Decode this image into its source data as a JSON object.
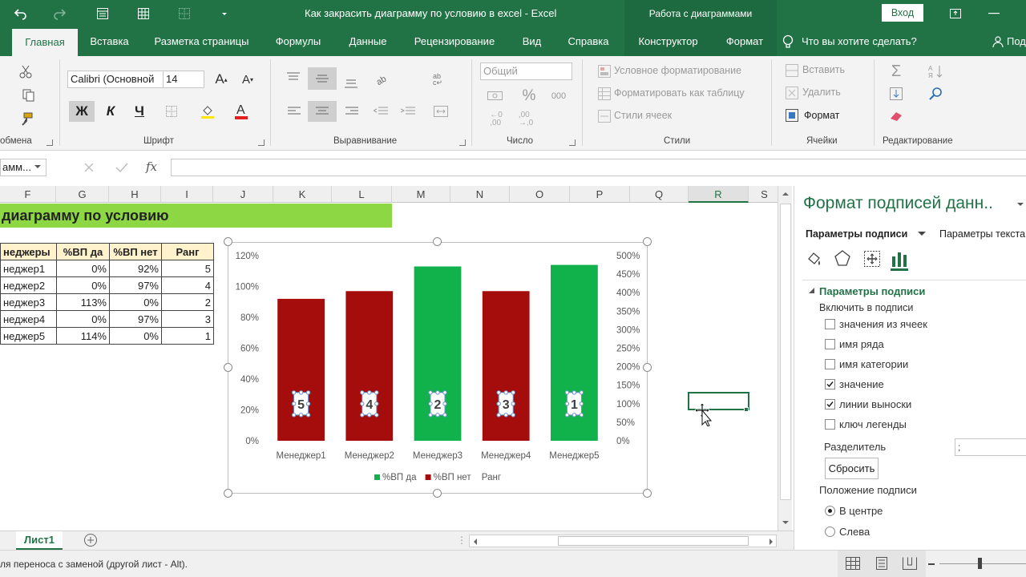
{
  "titlebar": {
    "title": "Как закрасить диаграмму по условию в excel  -  Excel",
    "context_band": "Работа с диаграммами",
    "signin_label": "Вход"
  },
  "tabs": [
    "Главная",
    "Вставка",
    "Разметка страницы",
    "Формулы",
    "Данные",
    "Рецензирование",
    "Вид",
    "Справка",
    "Конструктор",
    "Формат"
  ],
  "tell_me": "Что вы хотите сделать?",
  "share_label": "Поде",
  "ribbon": {
    "groups": [
      "обмена",
      "Шрифт",
      "Выравнивание",
      "Число",
      "Стили",
      "Ячейки",
      "Редактирование"
    ],
    "font_name": "Calibri (Основной",
    "font_size": "14",
    "bold": "Ж",
    "italic": "К",
    "underline": "Ч",
    "number_format": "Общий",
    "percent": "%",
    "thousands": "000",
    "dec_inc": "←0\n,00",
    "dec_dec": ",00\n→,0",
    "cond_format": "Условное форматирование",
    "format_table": "Форматировать как таблицу",
    "cell_styles": "Стили ячеек",
    "insert": "Вставить",
    "delete": "Удалить",
    "format": "Формат"
  },
  "formula_bar": {
    "name_box": "амм...",
    "fx": "fx",
    "value": ""
  },
  "columns": [
    "F",
    "G",
    "H",
    "I",
    "J",
    "K",
    "L",
    "M",
    "N",
    "O",
    "P",
    "Q",
    "R",
    "S"
  ],
  "sheet": {
    "title_cell": "диаграмму по условию",
    "table_header": [
      "неджеры",
      "%ВП да",
      "%ВП нет",
      "Ранг"
    ],
    "rows": [
      [
        "неджер1",
        "0%",
        "92%",
        "5"
      ],
      [
        "неджер2",
        "0%",
        "97%",
        "4"
      ],
      [
        "неджер3",
        "113%",
        "0%",
        "2"
      ],
      [
        "неджер4",
        "0%",
        "97%",
        "3"
      ],
      [
        "неджер5",
        "114%",
        "0%",
        "1"
      ]
    ]
  },
  "chart_data": {
    "type": "bar",
    "categories": [
      "Менеджер1",
      "Менеджер2",
      "Менеджер3",
      "Менеджер4",
      "Менеджер5"
    ],
    "series": [
      {
        "name": "%ВП да",
        "values": [
          0,
          0,
          113,
          0,
          114
        ],
        "color": "#11b14b",
        "axis": "left"
      },
      {
        "name": "%ВП нет",
        "values": [
          92,
          97,
          0,
          97,
          0
        ],
        "color": "#a50d0d",
        "axis": "left"
      },
      {
        "name": "Ранг",
        "values": [
          5,
          4,
          2,
          3,
          1
        ],
        "axis": "right",
        "display": "data labels"
      }
    ],
    "y_left": {
      "min": 0,
      "max": 120,
      "step": 20,
      "ticks": [
        "0%",
        "20%",
        "40%",
        "60%",
        "80%",
        "100%",
        "120%"
      ]
    },
    "y_right": {
      "min": 0,
      "max": 500,
      "step": 50,
      "ticks": [
        "0%",
        "50%",
        "100%",
        "150%",
        "200%",
        "250%",
        "300%",
        "350%",
        "400%",
        "450%",
        "500%"
      ]
    },
    "rank_labels": [
      "5",
      "4",
      "2",
      "3",
      "1"
    ],
    "legend": [
      "%ВП да",
      "%ВП нет",
      "Ранг"
    ],
    "legend_position": "bottom",
    "grid": false
  },
  "sheet_tab": "Лист1",
  "status_text": "ля переноса с заменой (другой лист - Alt).",
  "pane": {
    "title": "Формат подписей данн..",
    "tab_active": "Параметры подписи",
    "tab_other": "Параметры текста",
    "section": "Параметры подписи",
    "include_label": "Включить в подписи",
    "options": [
      {
        "label": "значения из ячеек",
        "checked": false
      },
      {
        "label": "имя ряда",
        "checked": false
      },
      {
        "label": "имя категории",
        "checked": false
      },
      {
        "label": "значение",
        "checked": true
      },
      {
        "label": "линии выноски",
        "checked": true
      },
      {
        "label": "ключ легенды",
        "checked": false
      }
    ],
    "separator_label": "Разделитель",
    "separator_value": ";",
    "reset_label": "Сбросить",
    "position_label": "Положение подписи",
    "positions": [
      {
        "label": "В центре",
        "selected": true
      },
      {
        "label": "Слева",
        "selected": false
      }
    ]
  },
  "colors": {
    "excel_green": "#217346",
    "title_fill": "#8ed744"
  }
}
